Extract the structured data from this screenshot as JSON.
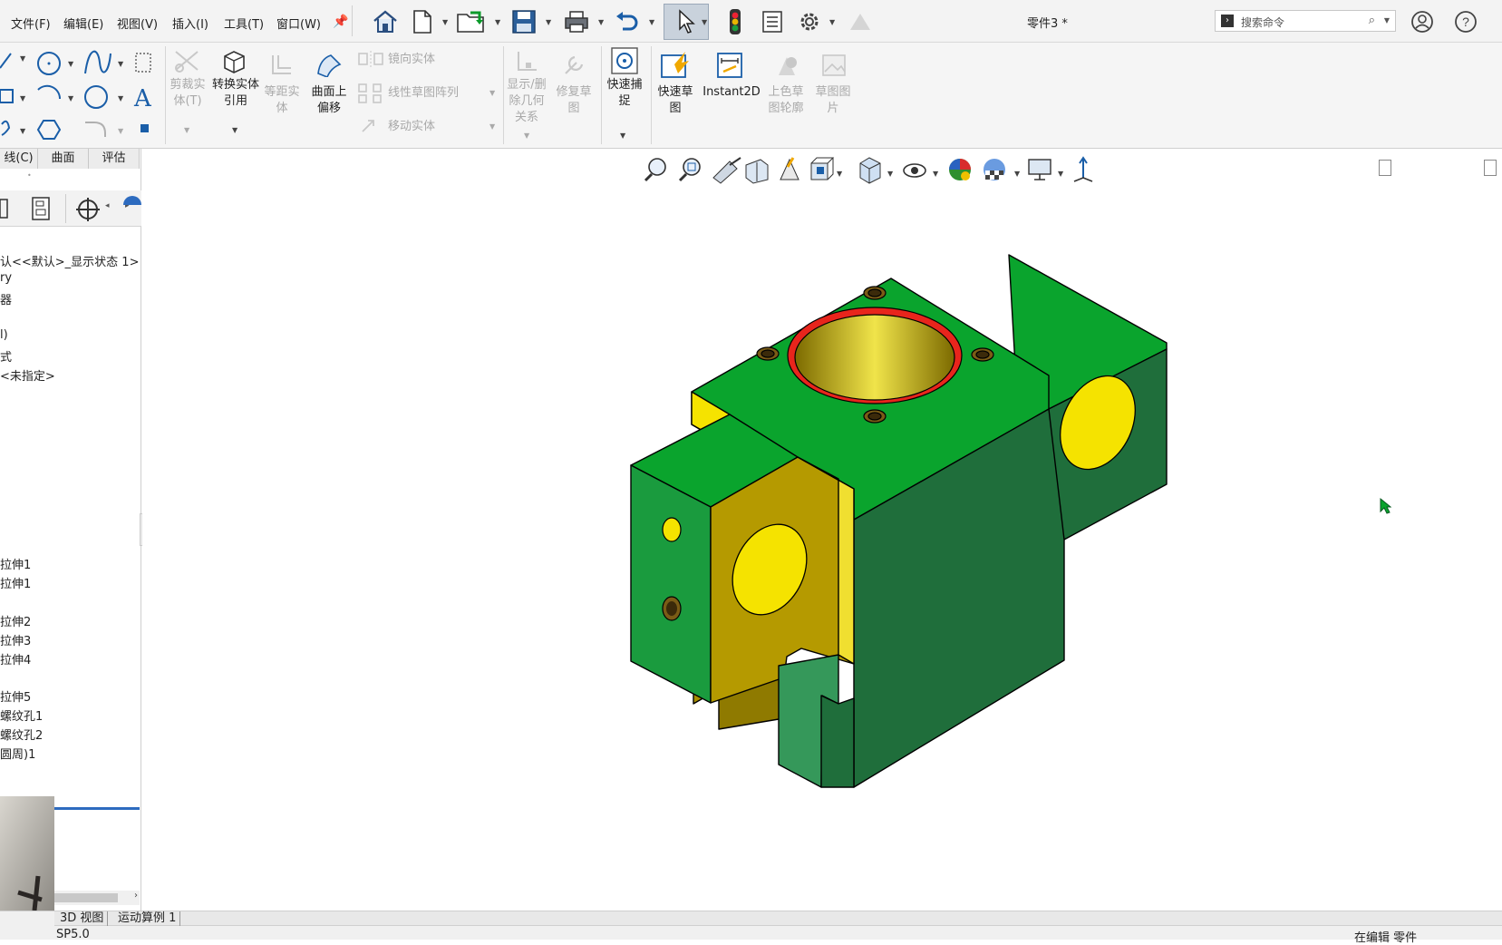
{
  "menu": [
    "文件(F)",
    "编辑(E)",
    "视图(V)",
    "插入(I)",
    "工具(T)",
    "窗口(W)"
  ],
  "doc_title": "零件3 *",
  "search": {
    "placeholder": "搜索命令"
  },
  "ribbon": {
    "trim": "剪裁实体(T)",
    "convert": "转换实体引用",
    "offset_entity": "等距实体",
    "offset_surface": "曲面上偏移",
    "mirror": "镜向实体",
    "linear_pattern": "线性草图阵列",
    "move": "移动实体",
    "display_relations": "显示/删除几何关系",
    "repair": "修复草图",
    "quick_snap": "快速捕捉",
    "rapid_sketch": "快速草图",
    "instant2d": "Instant2D",
    "shaded_contour": "上色草图轮廓",
    "sketch_picture": "草图图片"
  },
  "panel_tabs": [
    "线(C)",
    "曲面",
    "评估"
  ],
  "tree_items": [
    "认<<默认>_显示状态 1>",
    "ry",
    "器",
    "l)",
    "式",
    "<未指定>",
    "拉伸1",
    "拉伸1",
    "拉伸2",
    "拉伸3",
    "拉伸4",
    "拉伸5",
    "螺纹孔1",
    "螺纹孔2",
    "圆周)1"
  ],
  "bottom_tabs": [
    "3D 视图",
    "运动算例 1"
  ],
  "status": {
    "left": "SP5.0",
    "right": "在编辑 零件"
  },
  "colors": {
    "part_green": "#0aa42d",
    "part_dark_green": "#1f6e3b",
    "hole_yellow": "#f5e300",
    "edge_red": "#e8251c",
    "accent": "#1f7bd1"
  }
}
